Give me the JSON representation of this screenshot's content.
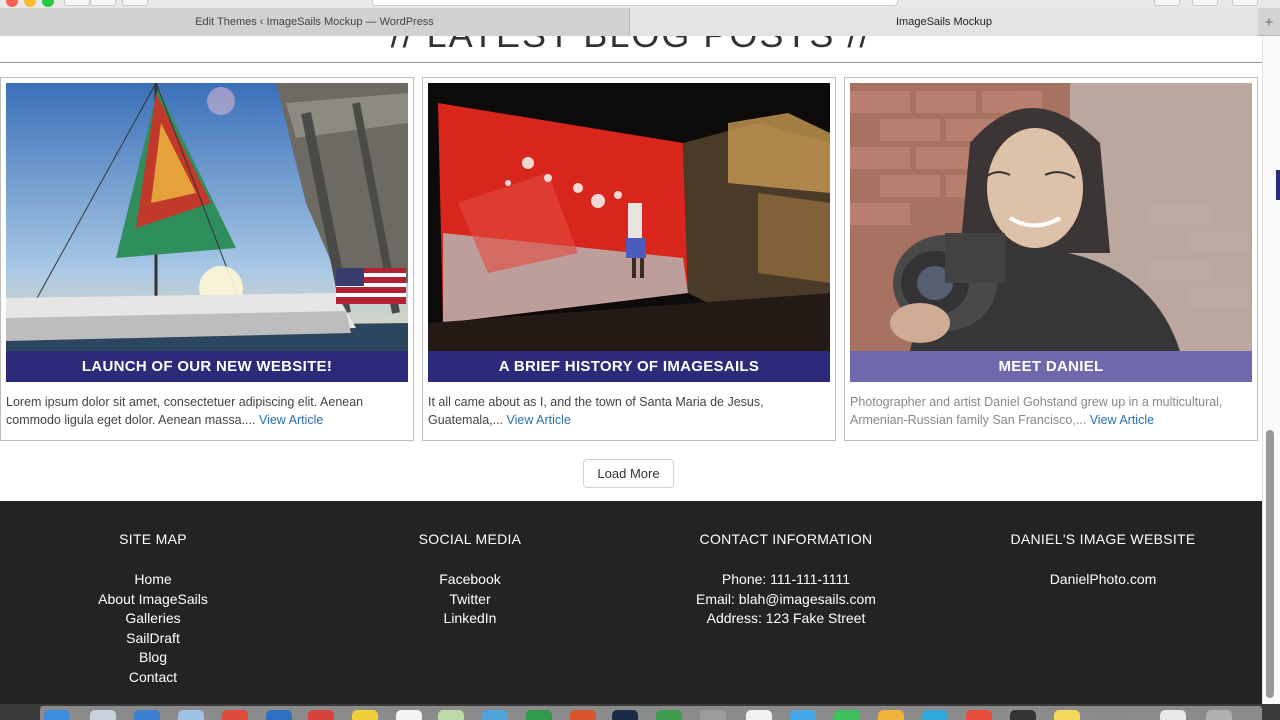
{
  "browser": {
    "tabs": [
      {
        "label": "Edit Themes ‹ ImageSails Mockup — WordPress"
      },
      {
        "label": "ImageSails Mockup"
      }
    ],
    "new_tab_label": "+"
  },
  "section": {
    "title": "// LATEST BLOG POSTS //"
  },
  "posts": [
    {
      "title": "LAUNCH OF OUR NEW WEBSITE!",
      "excerpt": "Lorem ipsum dolor sit amet, consectetuer adipiscing elit. Aenean commodo ligula eget dolor. Aenean massa....",
      "link": "View Article"
    },
    {
      "title": "A BRIEF HISTORY OF IMAGESAILS",
      "excerpt": "It all came about as I, and the town of Santa Maria de Jesus, Guatemala,...",
      "link": "View Article"
    },
    {
      "title": "MEET DANIEL",
      "excerpt": " Photographer and artist Daniel Gohstand grew up in a multicultural, Armenian-Russian family San Francisco,...",
      "link": "View Article"
    }
  ],
  "load_more_label": "Load More",
  "footer": {
    "site_map": {
      "heading": "SITE MAP",
      "links": [
        "Home",
        "About ImageSails",
        "Galleries",
        "SailDraft",
        "Blog",
        "Contact"
      ]
    },
    "social": {
      "heading": "SOCIAL MEDIA",
      "links": [
        "Facebook",
        "Twitter",
        "LinkedIn"
      ]
    },
    "contact": {
      "heading": "CONTACT INFORMATION",
      "lines": [
        "Phone: 111-111-1111",
        "Email: blah@imagesails.com",
        "Address: 123 Fake Street"
      ]
    },
    "website": {
      "heading": "DANIEL'S IMAGE WEBSITE",
      "links": [
        "DanielPhoto.com"
      ]
    }
  },
  "colors": {
    "banner": "#2e2a7a",
    "banner_faded": "#6e68ad",
    "footer_bg": "#232323",
    "link": "#2a6fb0"
  }
}
